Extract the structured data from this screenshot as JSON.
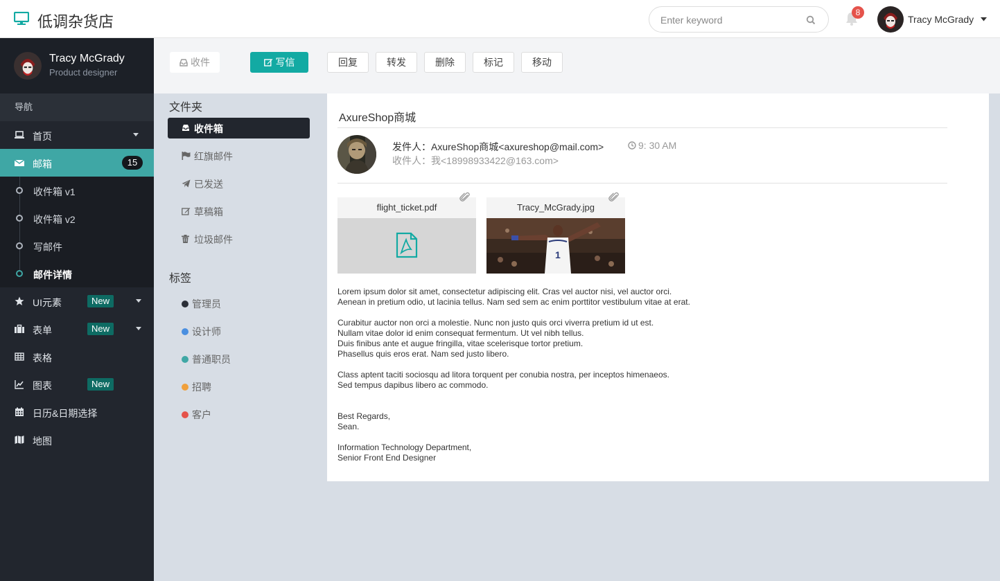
{
  "app": {
    "title": "低调杂货店"
  },
  "header": {
    "search_placeholder": "Enter keyword",
    "notification_count": "8",
    "user_name": "Tracy McGrady"
  },
  "sidebar": {
    "profile": {
      "name": "Tracy McGrady",
      "role": "Product designer"
    },
    "nav_header": "导航",
    "items": [
      {
        "label": "首页",
        "icon": "laptop-icon"
      },
      {
        "label": "邮箱",
        "icon": "envelope-icon",
        "badge": "15"
      },
      {
        "label": "UI元素",
        "icon": "star-icon",
        "badge": "New"
      },
      {
        "label": "表单",
        "icon": "briefcase-icon",
        "badge": "New"
      },
      {
        "label": "表格",
        "icon": "table-icon"
      },
      {
        "label": "图表",
        "icon": "line-chart-icon",
        "badge": "New"
      },
      {
        "label": "日历&日期选择",
        "icon": "calendar-icon"
      },
      {
        "label": "地图",
        "icon": "map-icon"
      }
    ],
    "mail_subitems": [
      "收件箱 v1",
      "收件箱 v2",
      "写邮件",
      "邮件详情"
    ]
  },
  "toolbar": {
    "inbox": "收件",
    "compose": "写信",
    "reply": "回复",
    "forward": "转发",
    "delete": "删除",
    "mark": "标记",
    "move": "移动"
  },
  "folders": {
    "title": "文件夹",
    "items": [
      "收件箱",
      "红旗邮件",
      "已发送",
      "草稿箱",
      "垃圾邮件"
    ]
  },
  "tags": {
    "title": "标签",
    "items": [
      {
        "label": "管理员",
        "color": "#2b2f38"
      },
      {
        "label": "设计师",
        "color": "#4a8fe0"
      },
      {
        "label": "普通职员",
        "color": "#3fa7a5"
      },
      {
        "label": "招聘",
        "color": "#f0a03c"
      },
      {
        "label": "客户",
        "color": "#e5534b"
      }
    ]
  },
  "mail": {
    "subject": "AxureShop商城",
    "from": "发件人：AxureShop商城<axureshop@mail.com>",
    "time": "9: 30 AM",
    "to": "收件人：我<18998933422@163.com>",
    "attachments": [
      "flight_ticket.pdf",
      "Tracy_McGrady.jpg"
    ],
    "body": [
      "Lorem ipsum dolor sit amet, consectetur adipiscing elit. Cras vel auctor nisi, vel auctor orci.",
      "Aenean in pretium odio, ut lacinia tellus. Nam sed sem ac enim porttitor vestibulum vitae at erat.",
      "",
      "Curabitur auctor non orci a molestie. Nunc non justo quis orci viverra pretium id ut est.",
      "Nullam vitae dolor id enim consequat fermentum. Ut vel nibh tellus.",
      "Duis finibus ante et augue fringilla, vitae scelerisque tortor pretium.",
      "Phasellus quis eros erat. Nam sed justo libero.",
      "",
      "Class aptent taciti sociosqu ad litora torquent per conubia nostra, per inceptos himenaeos.",
      "Sed tempus dapibus libero ac commodo.",
      "",
      "",
      "Best Regards,",
      "Sean.",
      "",
      "Information Technology Department,",
      "Senior Front End Designer"
    ]
  },
  "colors": {
    "accent": "#13aaa3",
    "sidebar": "#22262e",
    "active_nav": "#3fa7a5"
  }
}
